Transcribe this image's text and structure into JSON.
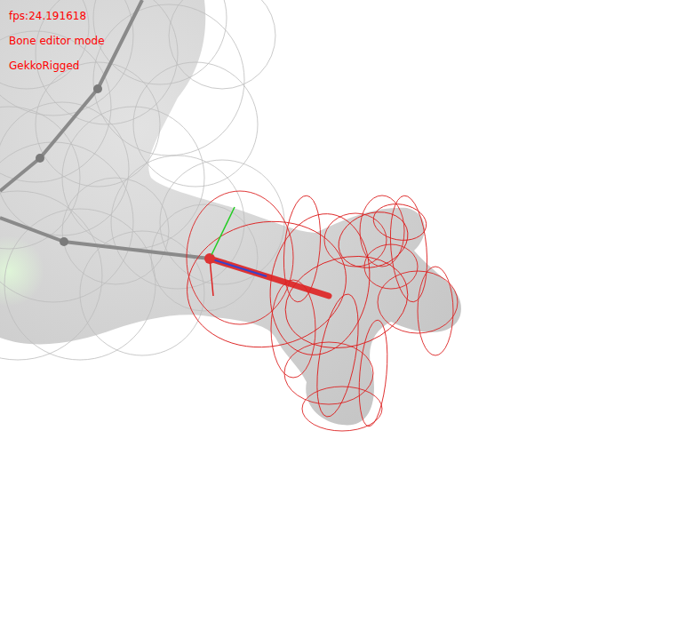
{
  "overlay": {
    "fps": "fps:24.191618",
    "mode": "Bone editor mode",
    "model": "GekkoRigged"
  },
  "bones": [
    {
      "selected": false
    },
    {
      "selected": false
    },
    {
      "selected": true
    }
  ]
}
